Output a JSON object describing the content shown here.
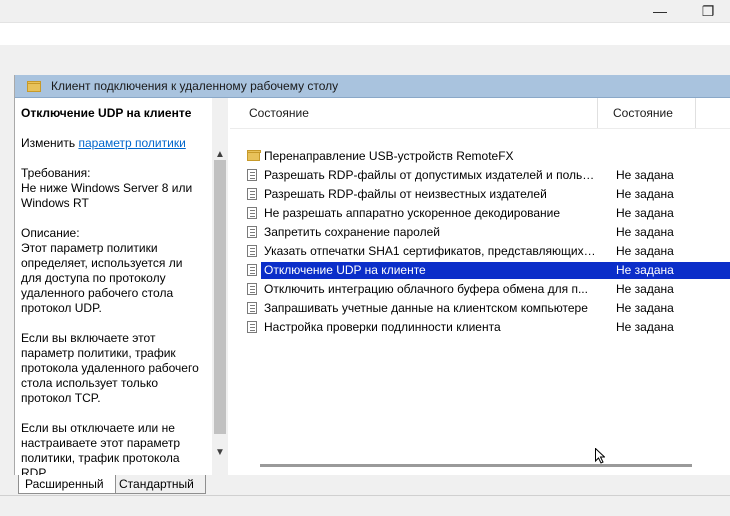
{
  "window": {
    "minimize_glyph": "—",
    "restore_glyph": "❐"
  },
  "header": {
    "title": "Клиент подключения к удаленному рабочему столу",
    "icon": "folder-icon"
  },
  "left_pane": {
    "selected_title": "Отключение UDP на клиенте",
    "edit_prefix": "Изменить ",
    "edit_link": "параметр политики",
    "requirements": "Требования:\nНе ниже Windows Server 8 или Windows RT",
    "description_1": "Описание:\nЭтот параметр политики определяет, используется ли для доступа по протоколу удаленного рабочего стола протокол UDP.",
    "description_2": "Если вы включаете этот параметр политики, трафик протокола удаленного рабочего стола использует только протокол TCP.",
    "description_3": "Если вы отключаете или не настраиваете этот параметр политики, трафик протокола RDP"
  },
  "list": {
    "columns": [
      "Состояние",
      "Состояние"
    ],
    "rows": [
      {
        "icon": "folder-icon",
        "label": "Перенаправление USB-устройств RemoteFX",
        "state": ""
      },
      {
        "icon": "policy-document-icon",
        "label": "Разрешать RDP-файлы от допустимых издателей и польз...",
        "state": "Не задана"
      },
      {
        "icon": "policy-document-icon",
        "label": "Разрешать RDP-файлы от неизвестных издателей",
        "state": "Не задана"
      },
      {
        "icon": "policy-document-icon",
        "label": "Не разрешать аппаратно ускоренное декодирование",
        "state": "Не задана"
      },
      {
        "icon": "policy-document-icon",
        "label": "Запретить сохранение паролей",
        "state": "Не задана"
      },
      {
        "icon": "policy-document-icon",
        "label": "Указать отпечатки SHA1 сертификатов, представляющих ...",
        "state": "Не задана"
      },
      {
        "icon": "policy-document-icon",
        "label": "Отключение UDP на клиенте",
        "state": "Не задана",
        "selected": true
      },
      {
        "icon": "policy-document-icon",
        "label": "Отключить интеграцию облачного буфера обмена для п...",
        "state": "Не задана"
      },
      {
        "icon": "policy-document-icon",
        "label": "Запрашивать учетные данные на клиентском компьютере",
        "state": "Не задана"
      },
      {
        "icon": "policy-document-icon",
        "label": "Настройка проверки подлинности клиента",
        "state": "Не задана"
      }
    ]
  },
  "tabs": [
    {
      "label": "Расширенный",
      "active": true
    },
    {
      "label": "Стандартный",
      "active": false
    }
  ],
  "colors": {
    "selection": "#0b2ec9",
    "header_bar": "#a9c3de",
    "link": "#0066cc"
  }
}
